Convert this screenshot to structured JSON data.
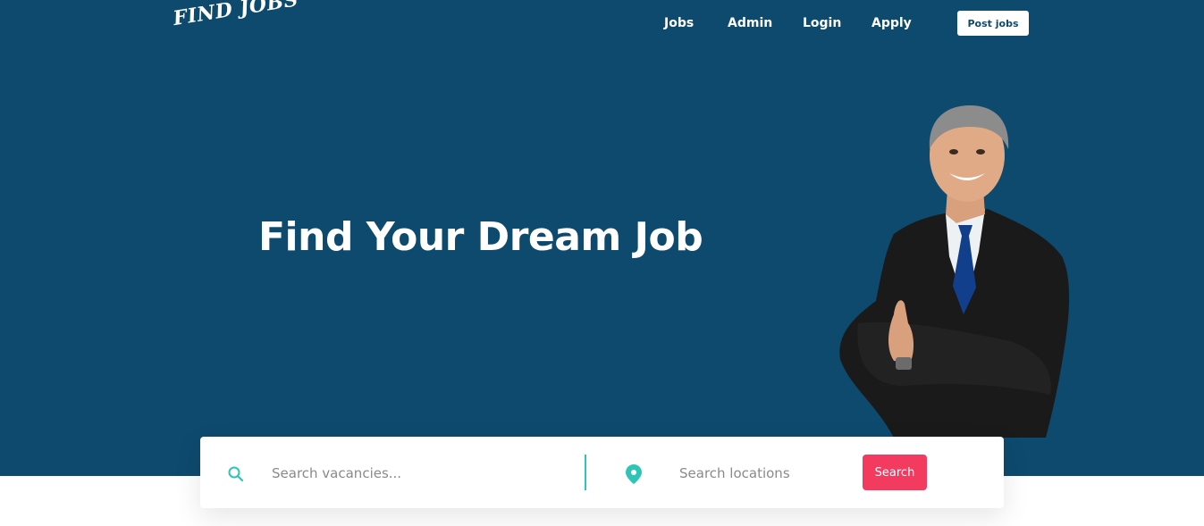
{
  "brand": {
    "logo_text": "FIND JOBS"
  },
  "nav": {
    "items": [
      {
        "label": "Jobs"
      },
      {
        "label": "Admin"
      },
      {
        "label": "Login"
      },
      {
        "label": "Apply"
      }
    ],
    "post_jobs_label": "Post jobs"
  },
  "hero": {
    "headline": "Find Your Dream Job",
    "image": "smiling-businessman-arms-crossed"
  },
  "search": {
    "vacancy_placeholder": "Search vacancies...",
    "location_placeholder": "Search locations",
    "button_label": "Search",
    "search_icon": "search-icon",
    "location_icon": "map-pin-icon"
  },
  "colors": {
    "hero_bg": "#0e4a6e",
    "accent_teal": "#2ec4b6",
    "button_red": "#f23b5f",
    "white": "#ffffff"
  }
}
